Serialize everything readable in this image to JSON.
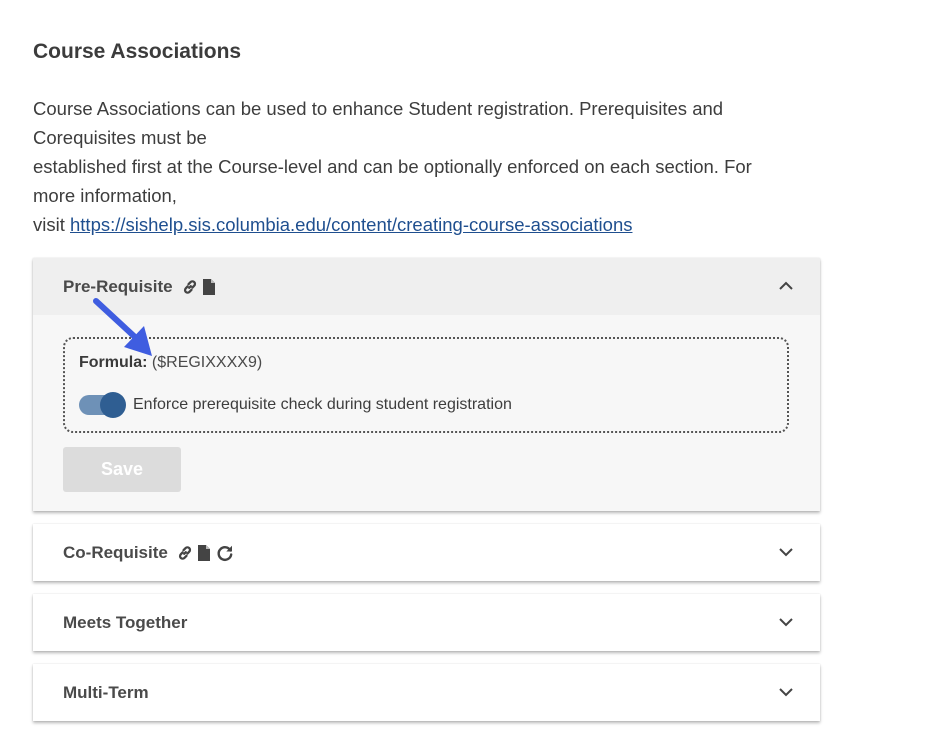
{
  "page": {
    "title": "Course Associations",
    "intro": {
      "line1": "Course Associations can be used to enhance Student registration. Prerequisites and",
      "line2": "Corequisites must be",
      "line3": "established first at the Course-level and can be optionally enforced on each section. For",
      "line4": "more information,",
      "visit_prefix": "visit ",
      "link_text": "https://sishelp.sis.columbia.edu/content/creating-course-associations"
    }
  },
  "panels": {
    "prerequisite": {
      "title": "Pre-Requisite",
      "expanded": true,
      "icons": [
        "link-icon",
        "document-icon"
      ],
      "formula_label": "Formula:",
      "formula_value": "($REGIXXXX9)",
      "toggle_on": true,
      "toggle_label": "Enforce prerequisite check during student registration",
      "save_label": "Save"
    },
    "corequisite": {
      "title": "Co-Requisite",
      "expanded": false,
      "icons": [
        "link-icon",
        "document-icon",
        "refresh-icon"
      ]
    },
    "meets_together": {
      "title": "Meets Together",
      "expanded": false
    },
    "multi_term": {
      "title": "Multi-Term",
      "expanded": false
    }
  },
  "colors": {
    "link": "#1f4f8f",
    "toggle_track": "#6e91b7",
    "toggle_knob": "#2f5e92",
    "annotation_arrow": "#3f5de0",
    "save_disabled": "#dcdcdc"
  }
}
